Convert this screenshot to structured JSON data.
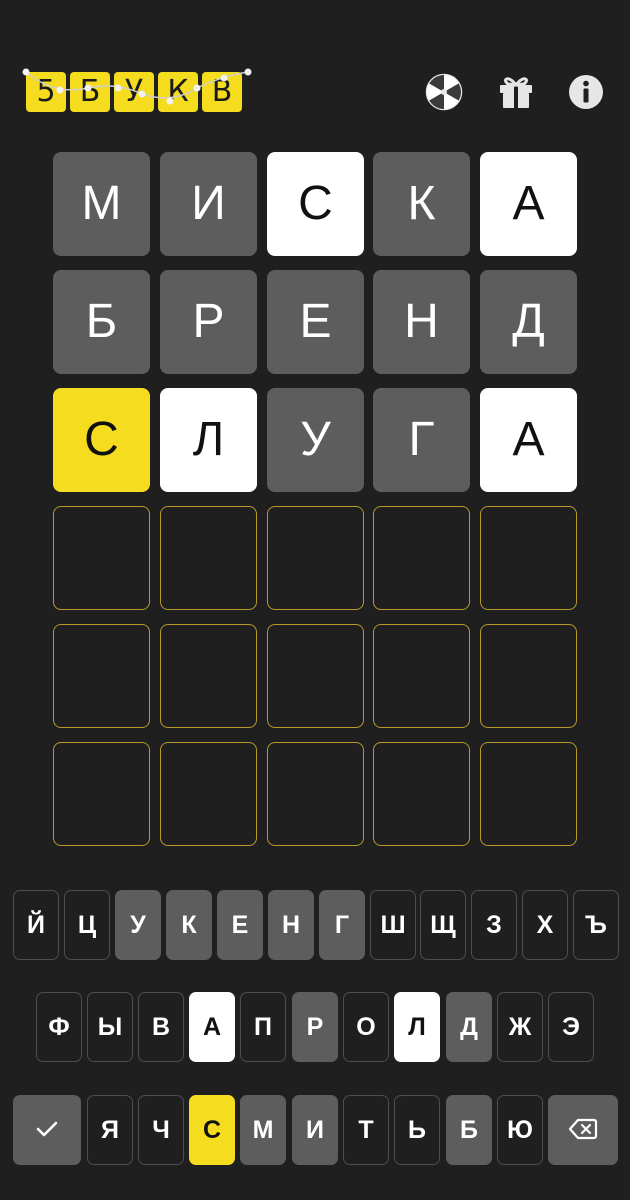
{
  "header": {
    "logo_letters": [
      "5",
      "Б",
      "У",
      "К",
      "В"
    ],
    "icons": [
      "spinner-wheel-icon",
      "gift-icon",
      "info-icon"
    ]
  },
  "colors": {
    "background": "#1f1f20",
    "absent": "#5d5d5d",
    "present": "#ffffff",
    "correct": "#f5dc1f",
    "empty_border": "#b8992a"
  },
  "board": {
    "rows": [
      {
        "letters": [
          "М",
          "И",
          "С",
          "К",
          "А"
        ],
        "states": [
          "absent",
          "absent",
          "present",
          "absent",
          "present"
        ]
      },
      {
        "letters": [
          "Б",
          "Р",
          "Е",
          "Н",
          "Д"
        ],
        "states": [
          "absent",
          "absent",
          "absent",
          "absent",
          "absent"
        ]
      },
      {
        "letters": [
          "С",
          "Л",
          "У",
          "Г",
          "А"
        ],
        "states": [
          "correct",
          "present",
          "absent",
          "absent",
          "present"
        ]
      },
      {
        "letters": [
          "",
          "",
          "",
          "",
          ""
        ],
        "states": [
          "empty",
          "empty",
          "empty",
          "empty",
          "empty"
        ]
      },
      {
        "letters": [
          "",
          "",
          "",
          "",
          ""
        ],
        "states": [
          "empty",
          "empty",
          "empty",
          "empty",
          "empty"
        ]
      },
      {
        "letters": [
          "",
          "",
          "",
          "",
          ""
        ],
        "states": [
          "empty",
          "empty",
          "empty",
          "empty",
          "empty"
        ]
      }
    ]
  },
  "keyboard": {
    "row1": [
      {
        "label": "Й",
        "state": "unused"
      },
      {
        "label": "Ц",
        "state": "unused"
      },
      {
        "label": "У",
        "state": "absent"
      },
      {
        "label": "К",
        "state": "absent"
      },
      {
        "label": "Е",
        "state": "absent"
      },
      {
        "label": "Н",
        "state": "absent"
      },
      {
        "label": "Г",
        "state": "absent"
      },
      {
        "label": "Ш",
        "state": "unused"
      },
      {
        "label": "Щ",
        "state": "unused"
      },
      {
        "label": "З",
        "state": "unused"
      },
      {
        "label": "Х",
        "state": "unused"
      },
      {
        "label": "Ъ",
        "state": "unused"
      }
    ],
    "row2": [
      {
        "label": "Ф",
        "state": "unused"
      },
      {
        "label": "Ы",
        "state": "unused"
      },
      {
        "label": "В",
        "state": "unused"
      },
      {
        "label": "А",
        "state": "present"
      },
      {
        "label": "П",
        "state": "unused"
      },
      {
        "label": "Р",
        "state": "absent"
      },
      {
        "label": "О",
        "state": "unused"
      },
      {
        "label": "Л",
        "state": "present"
      },
      {
        "label": "Д",
        "state": "absent"
      },
      {
        "label": "Ж",
        "state": "unused"
      },
      {
        "label": "Э",
        "state": "unused"
      }
    ],
    "row3": [
      {
        "label": "",
        "state": "action",
        "icon": "check-icon"
      },
      {
        "label": "Я",
        "state": "unused"
      },
      {
        "label": "Ч",
        "state": "unused"
      },
      {
        "label": "С",
        "state": "correct"
      },
      {
        "label": "М",
        "state": "absent"
      },
      {
        "label": "И",
        "state": "absent"
      },
      {
        "label": "Т",
        "state": "unused"
      },
      {
        "label": "Ь",
        "state": "unused"
      },
      {
        "label": "Б",
        "state": "absent"
      },
      {
        "label": "Ю",
        "state": "unused"
      },
      {
        "label": "",
        "state": "action",
        "icon": "backspace-icon"
      }
    ]
  }
}
